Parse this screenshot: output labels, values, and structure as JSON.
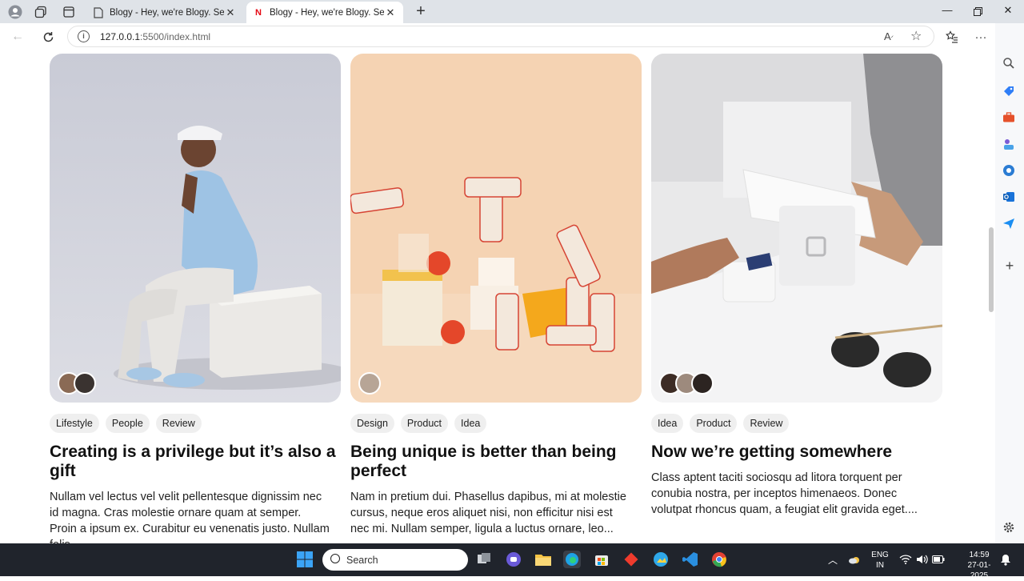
{
  "browser": {
    "tabs": [
      {
        "title": "Blogy - Hey, we're Blogy. See our",
        "active": false,
        "favicon": "page-icon"
      },
      {
        "title": "Blogy - Hey, we're Blogy. See our",
        "active": true,
        "favicon": "netflix-icon"
      }
    ],
    "url_host": "127.0.0.1",
    "url_rest": ":5500/index.html"
  },
  "cards": [
    {
      "tags": [
        "Lifestyle",
        "People",
        "Review"
      ],
      "title": "Creating is a privilege but it’s also a gift",
      "excerpt": "Nullam vel lectus vel velit pellentesque dignissim nec id magna. Cras molestie ornare quam at semper. Proin a ipsum ex. Curabitur eu venenatis justo. Nullam felis...",
      "image": "man-sitting-on-box-photo"
    },
    {
      "tags": [
        "Design",
        "Product",
        "Idea"
      ],
      "title": "Being unique is better than being perfect",
      "excerpt": "Nam in pretium dui. Phasellus dapibus, mi at molestie cursus, neque eros aliquet nisi, non efficitur nisi est nec mi. Nullam semper, ligula a luctus ornare, leo...",
      "image": "dandy-cans-product-photo"
    },
    {
      "tags": [
        "Idea",
        "Product",
        "Review"
      ],
      "title": "Now we’re getting somewhere",
      "excerpt": "Class aptent taciti sociosqu ad litora torquent per conubia nostra, per inceptos himenaeos. Donec volutpat rhoncus quam, a feugiat elit gravida eget....",
      "image": "card-payment-terminal-photo"
    }
  ],
  "taskbar": {
    "search_label": "Search",
    "lang_top": "ENG",
    "lang_bottom": "IN",
    "time": "14:59",
    "date": "27-01-2025"
  }
}
